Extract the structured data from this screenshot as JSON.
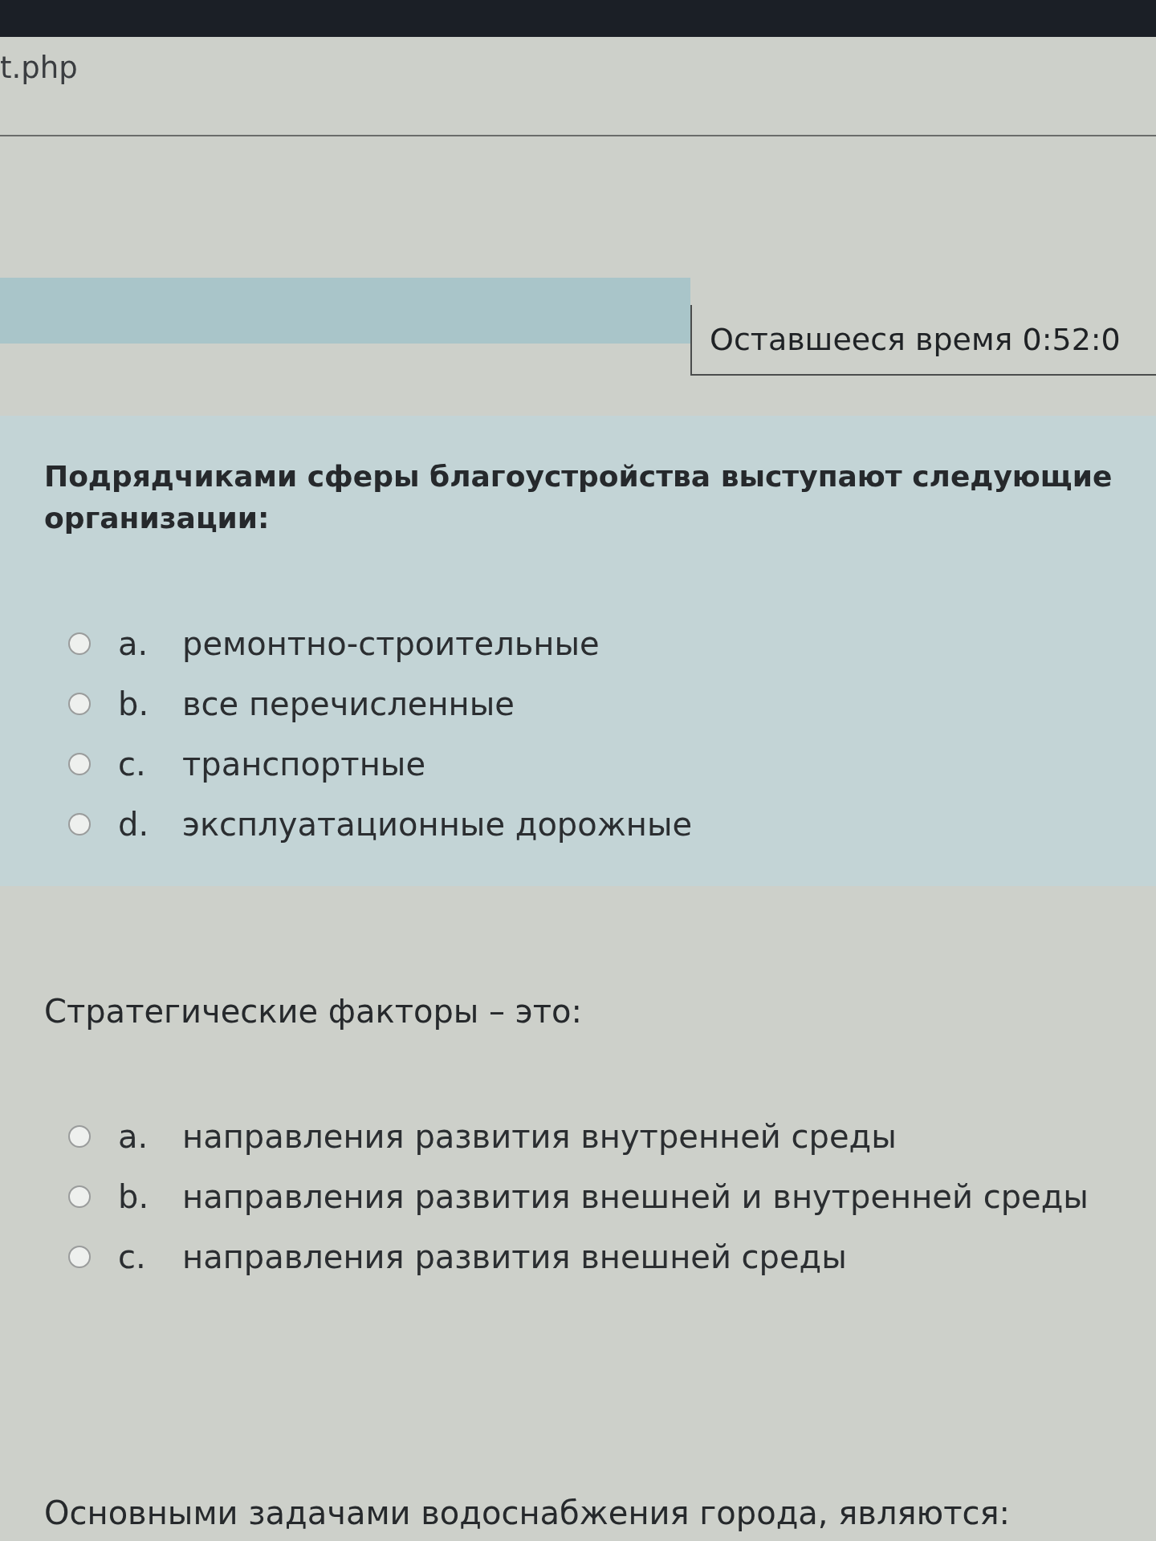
{
  "address_bar": {
    "url": "t.php"
  },
  "timer": {
    "label": "Оставшееся время 0:52:0"
  },
  "questions": [
    {
      "text": "Подрядчиками сферы благоустройства выступают следующие организации:",
      "highlighted": true,
      "options": [
        {
          "letter": "a.",
          "text": "ремонтно-строительные",
          "selected": false
        },
        {
          "letter": "b.",
          "text": "все перечисленные",
          "selected": false
        },
        {
          "letter": "c.",
          "text": "транспортные",
          "selected": false
        },
        {
          "letter": "d.",
          "text": "эксплуатационные дорожные",
          "selected": false
        }
      ]
    },
    {
      "text": "Стратегические факторы – это:",
      "highlighted": false,
      "options": [
        {
          "letter": "a.",
          "text": "направления развития внутренней среды",
          "selected": false
        },
        {
          "letter": "b.",
          "text": "направления развития внешней и внутренней среды",
          "selected": false
        },
        {
          "letter": "c.",
          "text": "направления развития внешней среды",
          "selected": false
        }
      ]
    },
    {
      "text": "Основными задачами водоснабжения города, являются:",
      "highlighted": false
    }
  ]
}
